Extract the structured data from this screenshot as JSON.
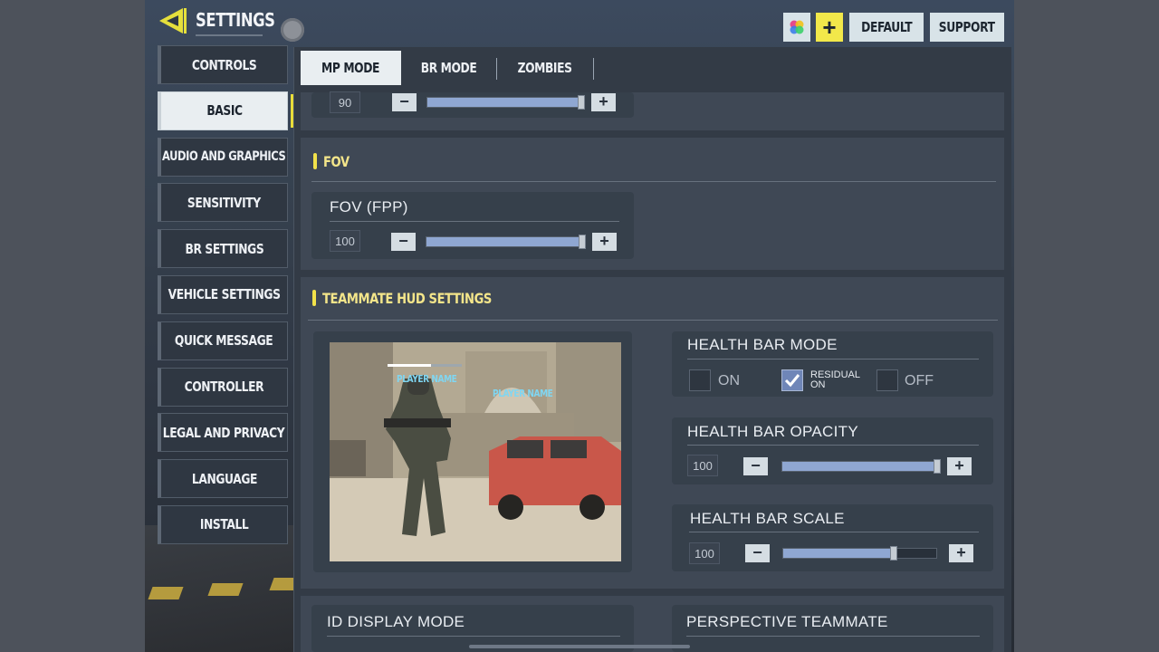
{
  "header": {
    "title": "SETTINGS",
    "default_label": "DEFAULT",
    "support_label": "SUPPORT",
    "plus_symbol": "+"
  },
  "nav": {
    "items": [
      {
        "label": "CONTROLS",
        "active": false
      },
      {
        "label": "BASIC",
        "active": true
      },
      {
        "label": "AUDIO AND GRAPHICS",
        "active": false
      },
      {
        "label": "SENSITIVITY",
        "active": false
      },
      {
        "label": "BR SETTINGS",
        "active": false
      },
      {
        "label": "VEHICLE SETTINGS",
        "active": false
      },
      {
        "label": "QUICK MESSAGE",
        "active": false
      },
      {
        "label": "CONTROLLER",
        "active": false
      },
      {
        "label": "LEGAL AND PRIVACY",
        "active": false
      },
      {
        "label": "LANGUAGE",
        "active": false
      },
      {
        "label": "INSTALL",
        "active": false
      }
    ]
  },
  "tabs": [
    {
      "label": "MP MODE",
      "active": true
    },
    {
      "label": "BR MODE",
      "active": false
    },
    {
      "label": "ZOMBIES",
      "active": false
    }
  ],
  "top_slider": {
    "value": "90",
    "level": 0.98
  },
  "fov": {
    "section_title": "FOV",
    "card_label": "FOV (FPP)",
    "value": "100",
    "level": 0.98
  },
  "teammate_hud": {
    "section_title": "TEAMMATE HUD SETTINGS",
    "preview": {
      "player_name_1": "PLAYER NAME",
      "player_name_2": "PLAYER NAME"
    },
    "health_bar_mode": {
      "label": "HEALTH BAR MODE",
      "options": [
        {
          "label": "ON",
          "checked": false
        },
        {
          "label_line1": "RESIDUAL",
          "label_line2": "ON",
          "checked": true
        },
        {
          "label": "OFF",
          "checked": false
        }
      ]
    },
    "health_bar_opacity": {
      "label": "HEALTH BAR OPACITY",
      "value": "100",
      "level": 0.98
    },
    "health_bar_scale": {
      "label": "HEALTH BAR SCALE",
      "value": "100",
      "level": 0.72
    }
  },
  "bottom": {
    "id_display_mode": "ID DISPLAY MODE",
    "perspective_teammate": "PERSPECTIVE TEAMMATE"
  },
  "symbols": {
    "minus": "−",
    "plus": "+"
  },
  "colors": {
    "accent_yellow": "#f2e24a",
    "slider_fill": "#8fa7d2",
    "active_tab_bg": "#e9eef1"
  }
}
